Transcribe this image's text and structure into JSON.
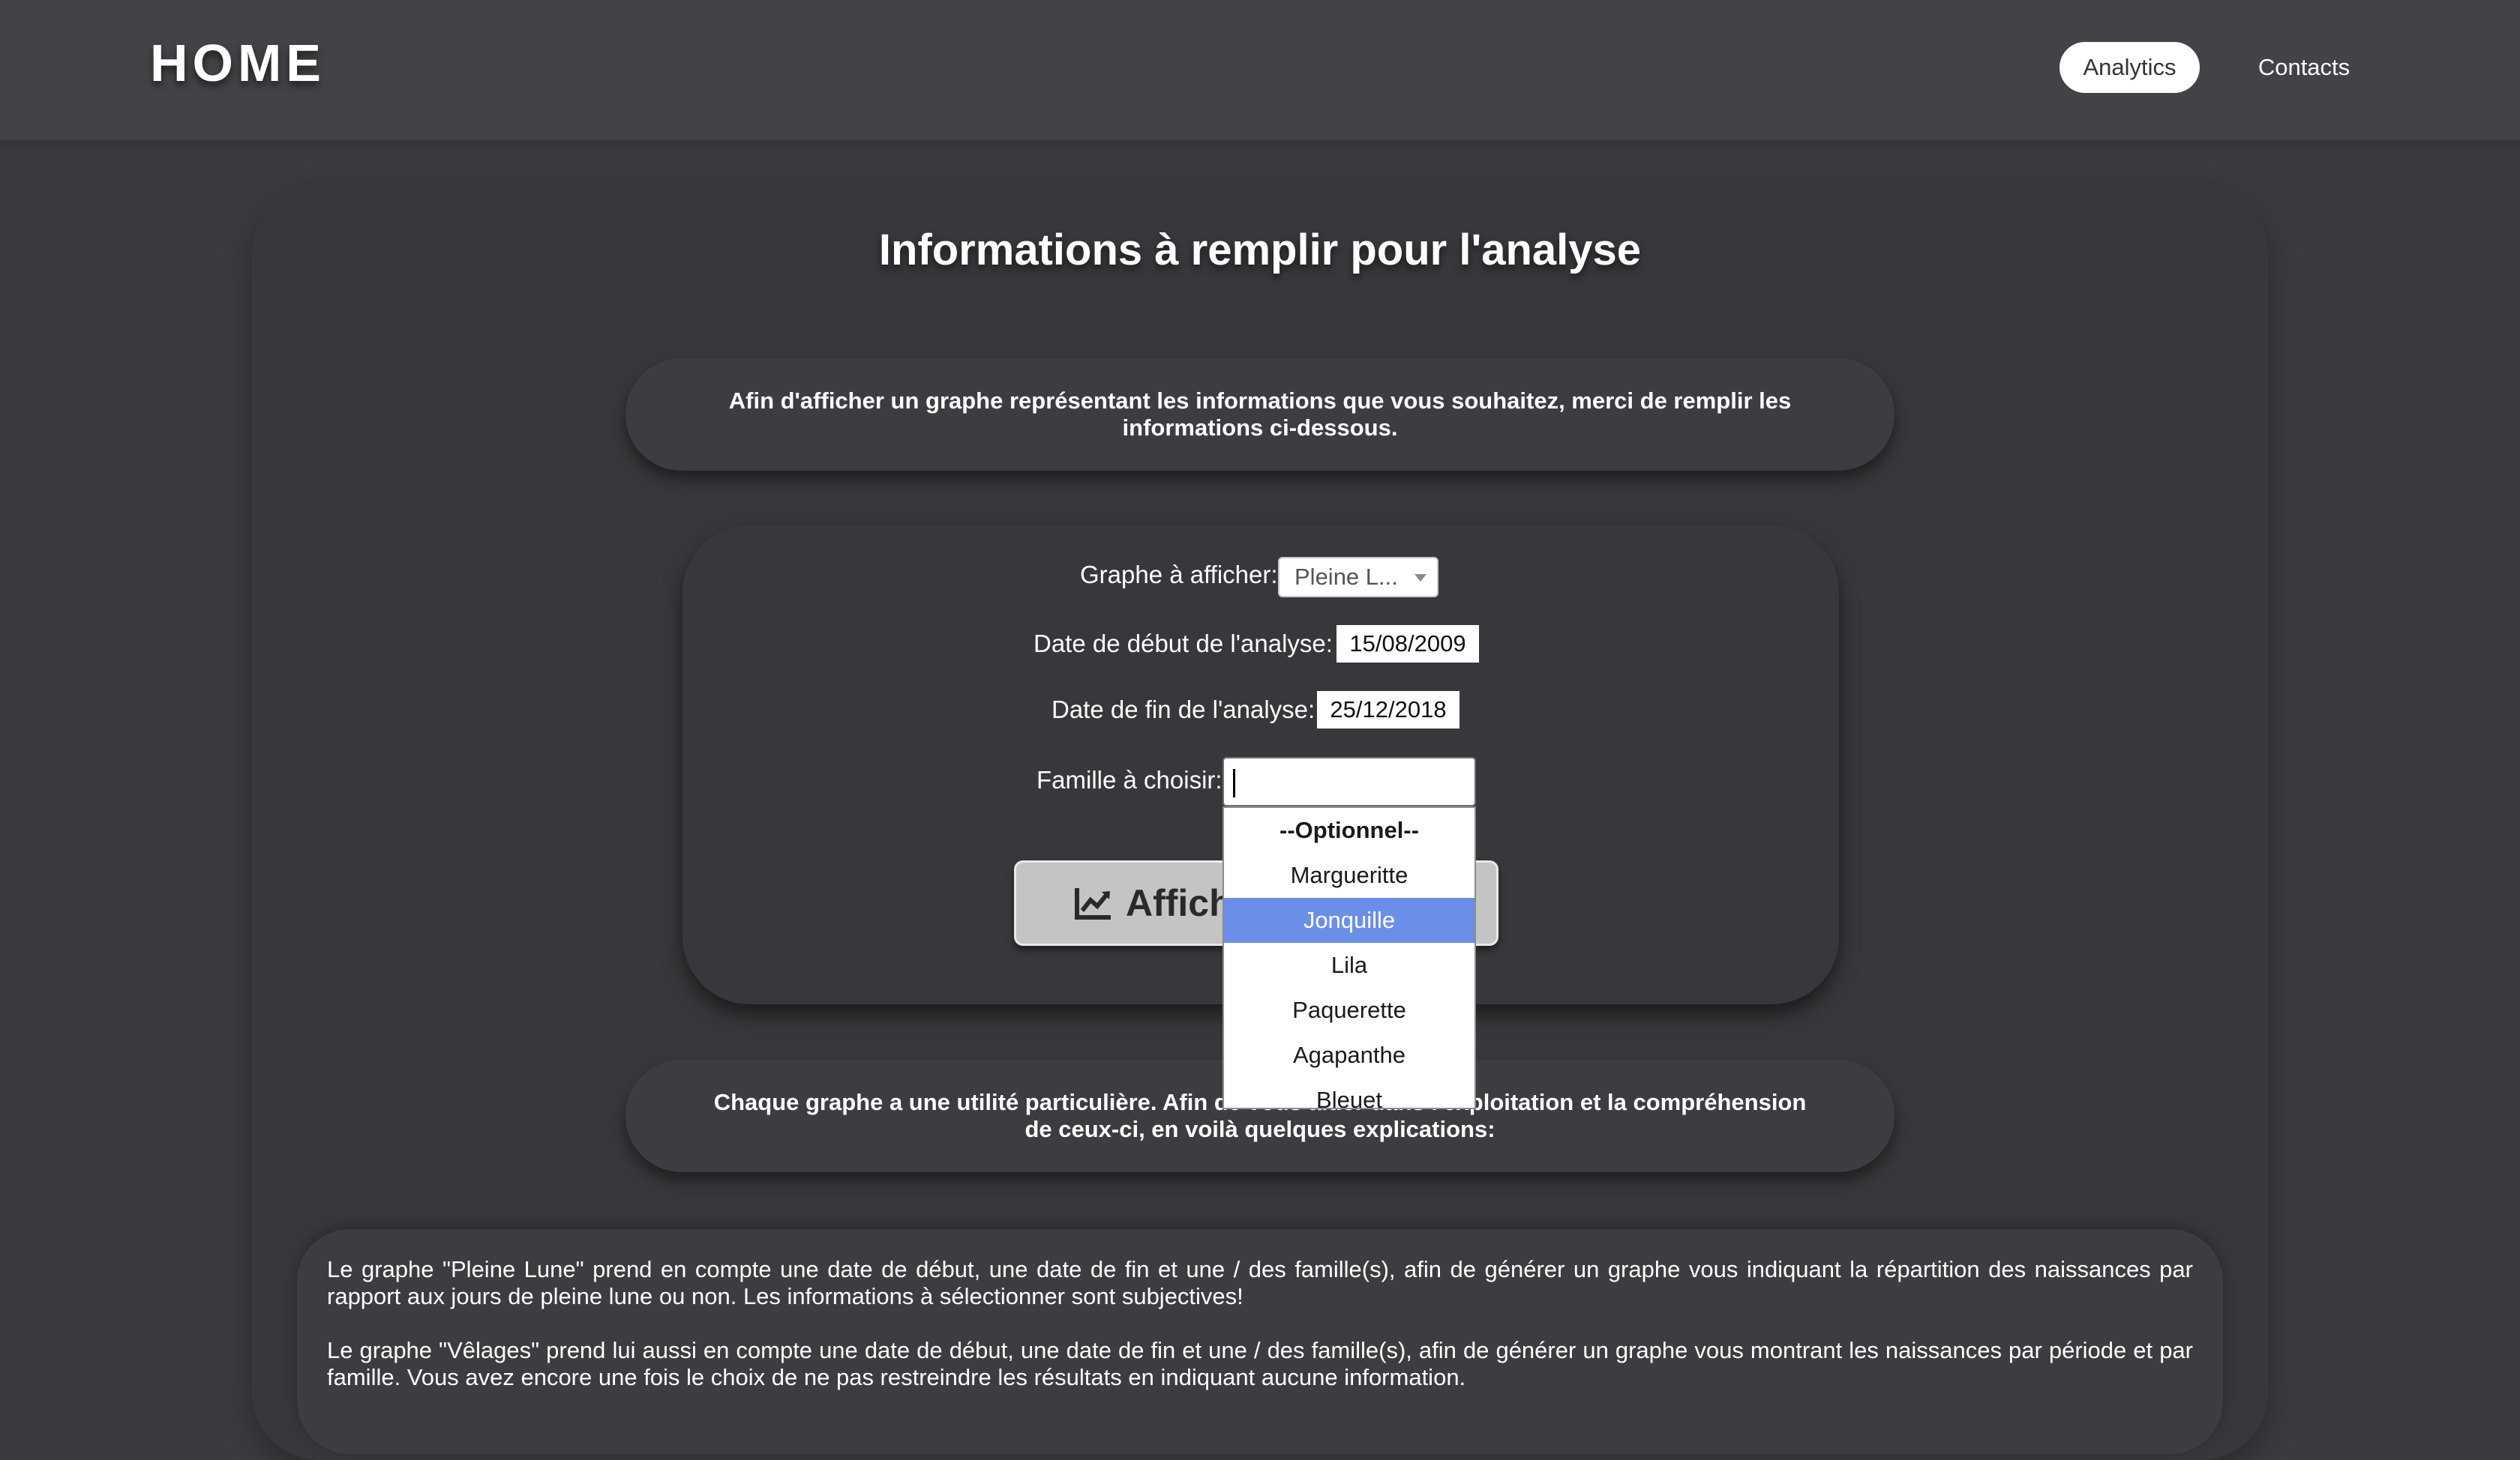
{
  "header": {
    "brand": "HOME",
    "nav": {
      "analytics": "Analytics",
      "contacts": "Contacts"
    }
  },
  "main": {
    "title": "Informations à remplir pour l'analyse",
    "intro_notice": "Afin d'afficher un graphe représentant les informations que vous souhaitez, merci de remplir les informations ci-dessous.",
    "form": {
      "graph_label": "Graphe à afficher:",
      "graph_value": "Pleine L...",
      "start_label": "Date de début de l'analyse:",
      "start_value": "15/08/2009",
      "end_label": "Date de fin de l'analyse:",
      "end_value": "25/12/2018",
      "family_label": "Famille à choisir:",
      "family_value": "",
      "submit_label": "Affich",
      "submit_icon": "line-chart-icon",
      "dropdown_options": [
        "--Optionnel--",
        "Margueritte",
        "Jonquille",
        "Lila",
        "Paquerette",
        "Agapanthe",
        "Bleuet"
      ],
      "highlighted_option": "Jonquille"
    },
    "explanation_notice": "Chaque graphe a une utilité particulière. Afin de vous aider dans l'exploitation et la compréhension de ceux-ci, en voilà quelques explications:",
    "explanations": [
      "Le graphe \"Pleine Lune\" prend en compte une date de début, une date de fin et une / des famille(s), afin de générer un graphe vous indiquant la répartition des naissances par rapport aux jours de pleine lune ou non. Les informations à sélectionner sont subjectives!",
      "Le graphe \"Vêlages\" prend lui aussi en compte une date de début, une date de fin et une / des famille(s), afin de générer un graphe vous montrant les naissances par période et par famille. Vous avez encore une fois le choix de ne pas restreindre les résultats en indiquant aucune information."
    ]
  },
  "colors": {
    "background": "#3b3b3f",
    "header": "#434347",
    "panel": "#38383c",
    "highlight": "#6b8fe8",
    "button": "#c4c4c4"
  }
}
